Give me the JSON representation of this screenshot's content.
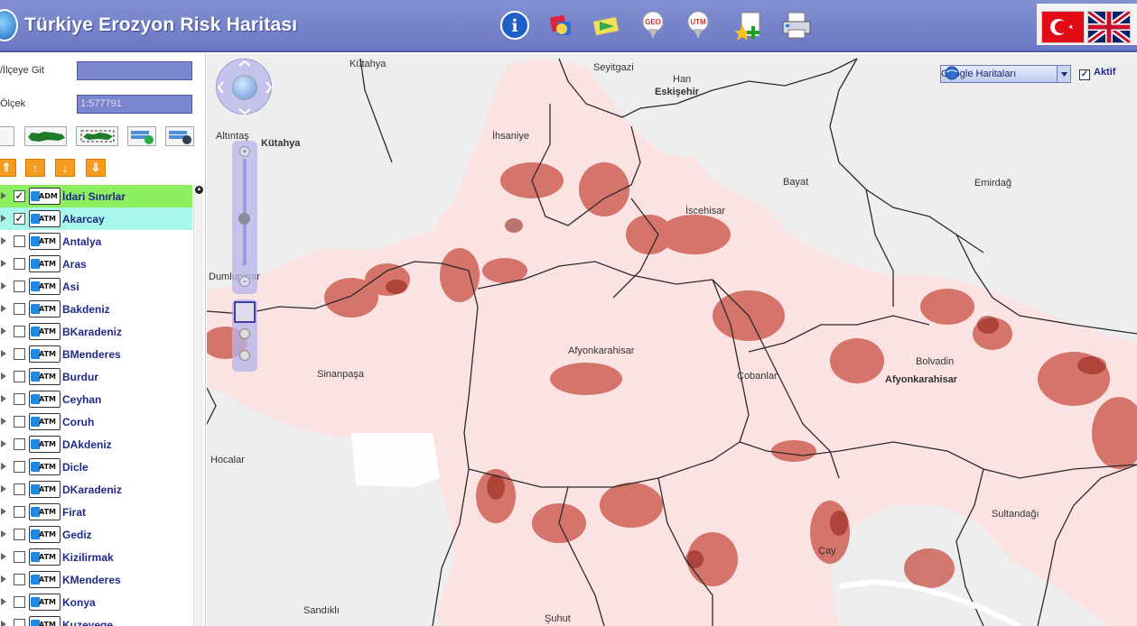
{
  "header": {
    "title": "Türkiye Erozyon Risk Haritası",
    "tools": [
      {
        "name": "info-icon",
        "label": "i"
      },
      {
        "name": "layers-icon",
        "label": ""
      },
      {
        "name": "export-icon",
        "label": ""
      },
      {
        "name": "geo-icon",
        "label": "GEO"
      },
      {
        "name": "utm-icon",
        "label": "UTM"
      },
      {
        "name": "add-favorite-icon",
        "label": ""
      },
      {
        "name": "print-icon",
        "label": ""
      }
    ],
    "flags": [
      "turkey-flag-icon",
      "uk-flag-icon"
    ]
  },
  "sidebar": {
    "goto_label": "/İlçeye Git",
    "goto_value": "",
    "scale_label": "Ölçek",
    "scale_value": "1:577791",
    "layers": [
      {
        "badge": "ADM",
        "label": "İdari Sınırlar",
        "checked": true,
        "highlight": "green"
      },
      {
        "badge": "ATM",
        "label": "Akarcay",
        "checked": true,
        "highlight": "cyan"
      },
      {
        "badge": "ATM",
        "label": "Antalya",
        "checked": false,
        "highlight": ""
      },
      {
        "badge": "ATM",
        "label": "Aras",
        "checked": false,
        "highlight": ""
      },
      {
        "badge": "ATM",
        "label": "Asi",
        "checked": false,
        "highlight": ""
      },
      {
        "badge": "ATM",
        "label": "Bakdeniz",
        "checked": false,
        "highlight": ""
      },
      {
        "badge": "ATM",
        "label": "BKaradeniz",
        "checked": false,
        "highlight": ""
      },
      {
        "badge": "ATM",
        "label": "BMenderes",
        "checked": false,
        "highlight": ""
      },
      {
        "badge": "ATM",
        "label": "Burdur",
        "checked": false,
        "highlight": ""
      },
      {
        "badge": "ATM",
        "label": "Ceyhan",
        "checked": false,
        "highlight": ""
      },
      {
        "badge": "ATM",
        "label": "Coruh",
        "checked": false,
        "highlight": ""
      },
      {
        "badge": "ATM",
        "label": "DAkdeniz",
        "checked": false,
        "highlight": ""
      },
      {
        "badge": "ATM",
        "label": "Dicle",
        "checked": false,
        "highlight": ""
      },
      {
        "badge": "ATM",
        "label": "DKaradeniz",
        "checked": false,
        "highlight": ""
      },
      {
        "badge": "ATM",
        "label": "Firat",
        "checked": false,
        "highlight": ""
      },
      {
        "badge": "ATM",
        "label": "Gediz",
        "checked": false,
        "highlight": ""
      },
      {
        "badge": "ATM",
        "label": "Kizilirmak",
        "checked": false,
        "highlight": ""
      },
      {
        "badge": "ATM",
        "label": "KMenderes",
        "checked": false,
        "highlight": ""
      },
      {
        "badge": "ATM",
        "label": "Konya",
        "checked": false,
        "highlight": ""
      },
      {
        "badge": "ATM",
        "label": "Kuzeyege",
        "checked": false,
        "highlight": ""
      }
    ]
  },
  "map": {
    "basemap_selector": "Google Haritaları",
    "active_label": "Aktif",
    "active_checked": true,
    "places": [
      {
        "text": "Kütahya",
        "bold": false
      },
      {
        "text": "Seyitgazi",
        "bold": false
      },
      {
        "text": "Han",
        "bold": false
      },
      {
        "text": "Eskişehir",
        "bold": true
      },
      {
        "text": "Altıntaş",
        "bold": false
      },
      {
        "text": "Kütahya",
        "bold": true
      },
      {
        "text": "İhsaniye",
        "bold": false
      },
      {
        "text": "Bayat",
        "bold": false
      },
      {
        "text": "Emirdağ",
        "bold": false
      },
      {
        "text": "İscehisar",
        "bold": false
      },
      {
        "text": "Dumlupınar",
        "bold": false
      },
      {
        "text": "Afyonkarahisar",
        "bold": false
      },
      {
        "text": "Sinanpaşa",
        "bold": false
      },
      {
        "text": "Çobanlar",
        "bold": false
      },
      {
        "text": "Bolvadin",
        "bold": false
      },
      {
        "text": "Afyonkarahisar",
        "bold": true
      },
      {
        "text": "Hocalar",
        "bold": false
      },
      {
        "text": "Sultandağı",
        "bold": false
      },
      {
        "text": "Çay",
        "bold": false
      },
      {
        "text": "Sandıklı",
        "bold": false
      },
      {
        "text": "Şuhut",
        "bold": false
      }
    ],
    "colors": {
      "province_fill": "#fbe3e3",
      "risk_high": "#b02a1a",
      "risk_mid": "#d96a5a",
      "background": "#eeeeee"
    }
  }
}
